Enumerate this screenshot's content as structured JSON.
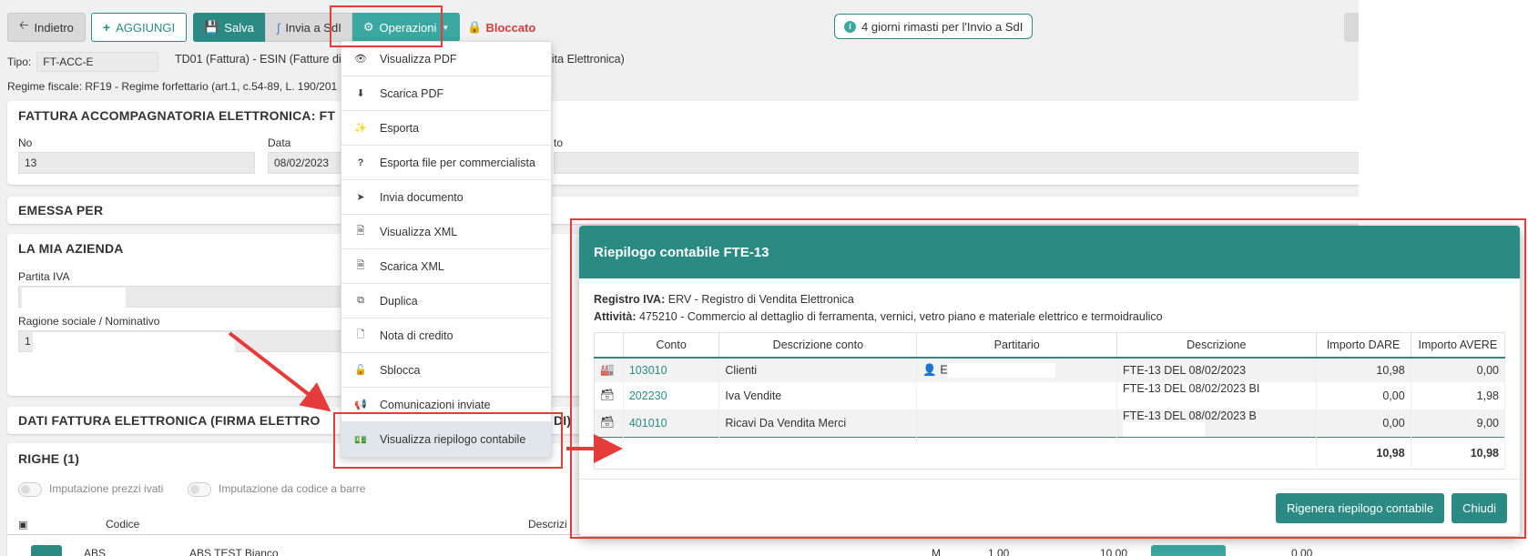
{
  "toolbar": {
    "back_label": "Indietro",
    "add_label": "AGGIUNGI",
    "save_label": "Salva",
    "send_sdi_label": "Invia a SdI",
    "operations_label": "Operazioni",
    "blocked_label": "Bloccato",
    "days_left_label": "4 giorni rimasti per l'Invio a SdI"
  },
  "doc": {
    "tipo_label": "Tipo:",
    "tipo_value": "FT-ACC-E",
    "tipo_desc": "TD01 (Fattura) - ESIN (Fatture di V",
    "tipo_desc_tail": "ndita Elettronica)",
    "regime": "Regime fiscale: RF19 - Regime forfettario (art.1, c.54-89, L. 190/201"
  },
  "invoice_card": {
    "title": "FATTURA ACCOMPAGNATORIA ELETTRONICA: FT",
    "no_label": "No",
    "no_value": "13",
    "date_label": "Data",
    "date_value": "08/02/2023",
    "extra_label": "to"
  },
  "emessa_title": "EMESSA PER",
  "azienda": {
    "title": "LA MIA AZIENDA",
    "piva_label": "Partita IVA",
    "ragione_label": "Ragione sociale / Nominativo",
    "ragione_value": "1"
  },
  "dati_title": "DATI FATTURA ELETTRONICA (FIRMA ELETTRO",
  "dati_title_tail": "DI)",
  "righe": {
    "title": "RIGHE (1)",
    "toggle1": "Imputazione prezzi ivati",
    "toggle2": "Imputazione da codice a barre",
    "col_codice": "Codice",
    "col_descr": "Descrizi",
    "row_code": "ABS",
    "row_descr": "ABS TEST Bianco",
    "row_um": "M",
    "row_qty": "1,00",
    "row_price": "10,00",
    "row_tail": "0,00"
  },
  "menu": {
    "items": [
      {
        "icon": "eye-icon",
        "label": "Visualizza PDF"
      },
      {
        "icon": "download-icon",
        "label": "Scarica PDF"
      },
      {
        "icon": "magic-wand-icon",
        "label": "Esporta"
      },
      {
        "icon": "question-icon",
        "label": "Esporta file per commercialista"
      },
      {
        "icon": "paper-plane-icon",
        "label": "Invia documento"
      },
      {
        "icon": "xml-file-icon",
        "label": "Visualizza XML"
      },
      {
        "icon": "xml-file-icon",
        "label": "Scarica XML"
      },
      {
        "icon": "copy-icon",
        "label": "Duplica"
      },
      {
        "icon": "file-icon",
        "label": "Nota di credito"
      },
      {
        "icon": "unlock-icon",
        "label": "Sblocca"
      },
      {
        "icon": "bullhorn-icon",
        "label": "Comunicazioni inviate"
      },
      {
        "icon": "money-icon",
        "label": "Visualizza riepilogo contabile"
      }
    ]
  },
  "modal": {
    "title": "Riepilogo contabile FTE-13",
    "registro_label": "Registro IVA:",
    "registro_value": "ERV - Registro di Vendita Elettronica",
    "attivita_label": "Attività:",
    "attivita_value": "475210 - Commercio al dettaglio di ferramenta, vernici, vetro piano e materiale elettrico e termoidraulico",
    "columns": [
      "Conto",
      "Descrizione conto",
      "Partitario",
      "Descrizione",
      "Importo DARE",
      "Importo AVERE"
    ],
    "rows": [
      {
        "icon": "industry-icon",
        "conto": "103010",
        "descr_conto": "Clienti",
        "partitario": "E",
        "descr": "FTE-13 DEL 08/02/2023",
        "dare": "10,98",
        "avere": "0,00"
      },
      {
        "icon": "archive-icon",
        "conto": "202230",
        "descr_conto": "Iva Vendite",
        "partitario": "",
        "descr": "FTE-13 DEL 08/02/2023 BI",
        "dare": "0,00",
        "avere": "1,98"
      },
      {
        "icon": "archive-icon",
        "conto": "401010",
        "descr_conto": "Ricavi Da Vendita Merci",
        "partitario": "",
        "descr": "FTE-13 DEL 08/02/2023 B",
        "dare": "0,00",
        "avere": "9,00"
      }
    ],
    "total_dare": "10,98",
    "total_avere": "10,98",
    "regen_label": "Rigenera riepilogo contabile",
    "close_label": "Chiudi"
  },
  "colors": {
    "teal": "#2b8b84",
    "teal_light": "#3aa7a0",
    "highlight_red": "#e53b3b",
    "blocked_red": "#d63b3b"
  }
}
